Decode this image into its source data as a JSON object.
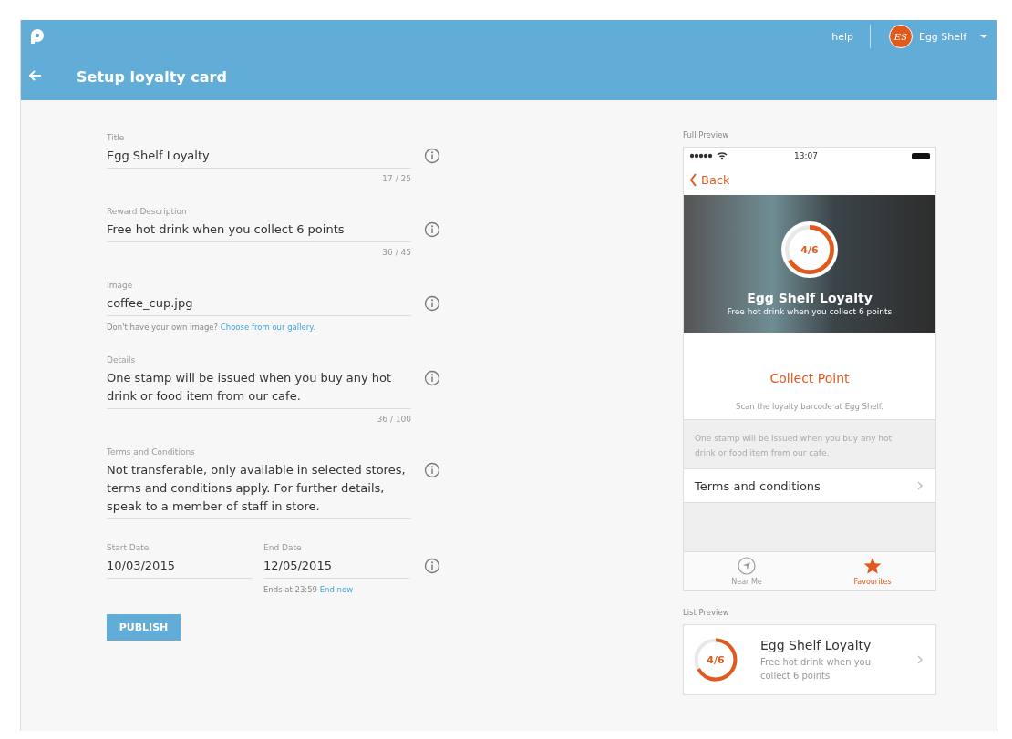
{
  "top_bar": {
    "help": "help",
    "user": {
      "initials": "ES",
      "name": "Egg Shelf"
    }
  },
  "page_title": "Setup loyalty card",
  "form": {
    "fields": [
      {
        "kind": "text",
        "label": "Title",
        "value": "Egg Shelf Loyalty",
        "counter": "17 / 25"
      },
      {
        "kind": "text",
        "label": "Reward Description",
        "value": "Free hot drink when you collect 6 points",
        "counter": "36 / 45"
      },
      {
        "kind": "text",
        "label": "Image",
        "value": "coffee_cup.jpg",
        "hint": "Don't have your own image?",
        "hint_link": "Choose from our gallery."
      },
      {
        "kind": "text",
        "label": "Details",
        "value": "One stamp will be issued when you buy any hot drink or food item from our cafe.",
        "counter": "36 / 100"
      },
      {
        "kind": "text",
        "label": "Terms and Conditions",
        "value": "Not transferable, only available in selected stores, terms and conditions apply. For further details, speak to a member of staff in store."
      },
      {
        "kind": "dates",
        "items": [
          {
            "label": "Start Date",
            "value": "10/03/2015"
          },
          {
            "label": "End Date",
            "value": "12/05/2015",
            "hint": "Ends at 23:59",
            "hint_link": "End now"
          }
        ]
      }
    ],
    "publish": "PUBLISH"
  },
  "full_preview": {
    "label": "Full Preview",
    "time": "13:07",
    "back": "Back",
    "progress": "4/6",
    "level": 0.667,
    "card_title": "Egg Shelf Loyalty",
    "card_subtitle": "Free hot drink when you collect 6 points",
    "collect": "Collect Point",
    "scan": "Scan the loyalty barcode at Egg Shelf.",
    "details": "One stamp will be issued when you buy any hot drink or food item from our cafe.",
    "terms": "Terms and conditions",
    "tabs": [
      {
        "label": "Near Me",
        "kind": "nearby",
        "selected": false
      },
      {
        "label": "Favourites",
        "kind": "favourites",
        "selected": true
      }
    ]
  },
  "list_preview": {
    "label": "List Preview",
    "progress": "4/6",
    "level": 0.667,
    "title": "Egg Shelf Loyalty",
    "subtitle": "Free hot drink when you collect 6 points"
  }
}
